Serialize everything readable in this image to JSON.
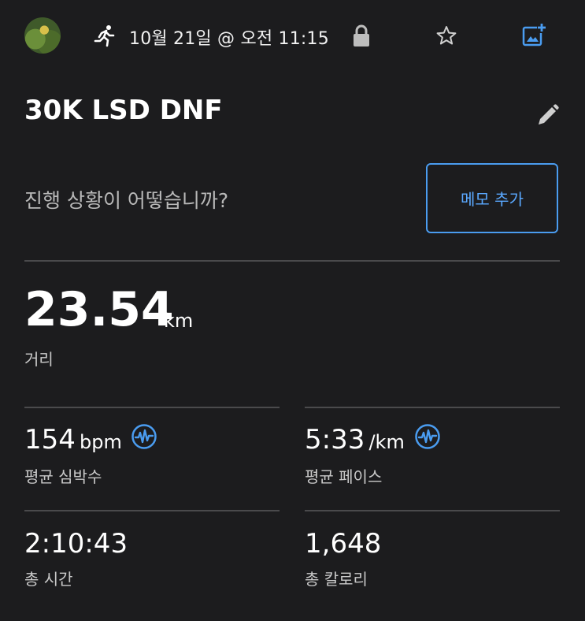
{
  "header": {
    "datetime": "10월 21일 @ 오전 11:15",
    "icons": [
      "running-icon",
      "lock-icon",
      "star-icon",
      "add-photo-icon"
    ]
  },
  "activity": {
    "title": "30K LSD DNF",
    "prompt": "진행 상황이 어떻습니까?",
    "memo_button": "메모 추가"
  },
  "distance": {
    "value": "23.54",
    "unit": "km",
    "label": "거리"
  },
  "stats": [
    {
      "value": "154",
      "unit": "bpm",
      "label": "평균 심박수",
      "icon": "heart-rate-wave-icon"
    },
    {
      "value": "5:33",
      "unit": "/km",
      "label": "평균 페이스",
      "icon": "pace-wave-icon"
    },
    {
      "value": "2:10:43",
      "unit": "",
      "label": "총 시간"
    },
    {
      "value": "1,648",
      "unit": "",
      "label": "총 칼로리"
    }
  ],
  "colors": {
    "background": "#1c1c1e",
    "accent": "#4a9cf0",
    "divider": "#4a4a4c"
  }
}
